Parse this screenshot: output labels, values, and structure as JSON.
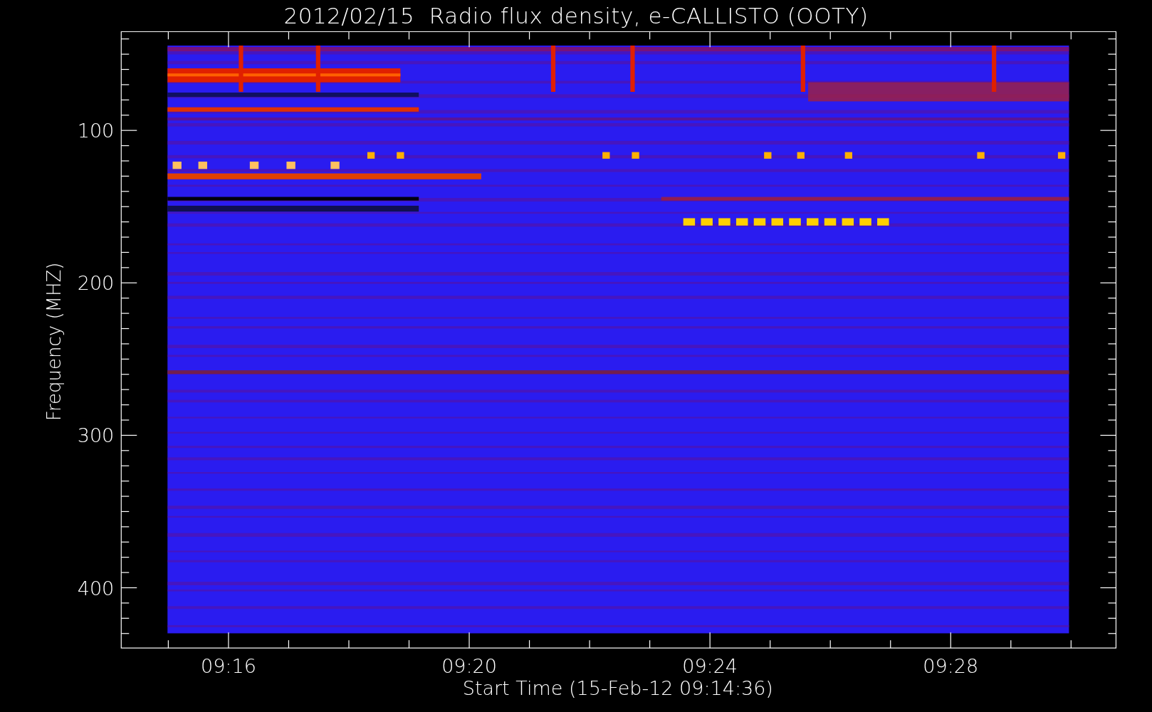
{
  "title": "2012/02/15  Radio flux density, e-CALLISTO (OOTY)",
  "y_axis": {
    "label": "Frequency (MHZ)",
    "ticks": [
      "100",
      "200",
      "300",
      "400"
    ]
  },
  "x_axis": {
    "label": "Start Time (15-Feb-12 09:14:36)",
    "ticks": [
      "09:16",
      "09:20",
      "09:24",
      "09:28"
    ]
  }
}
